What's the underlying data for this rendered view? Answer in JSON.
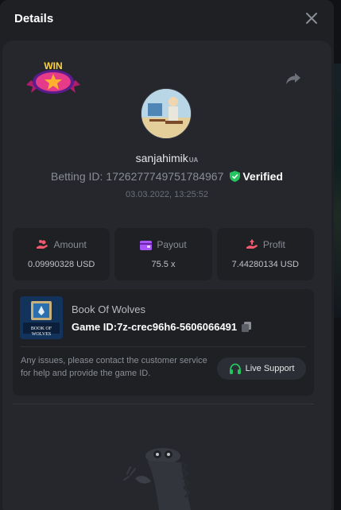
{
  "header": {
    "title": "Details"
  },
  "player": {
    "username": "sanjahimik",
    "country_code": "UA",
    "betting_id_label": "Betting ID:",
    "betting_id": "1726277749751784967",
    "verified_label": "Verified",
    "datetime": "03.03.2022, 13:25:52"
  },
  "badge": {
    "text": "WIN"
  },
  "stats": [
    {
      "label": "Amount",
      "value": "0.09990328 USD",
      "icon": "coins-hand-icon"
    },
    {
      "label": "Payout",
      "value": "75.5 x",
      "icon": "wallet-icon"
    },
    {
      "label": "Profit",
      "value": "7.44280134 USD",
      "icon": "profit-hand-icon"
    }
  ],
  "game": {
    "name": "Book Of Wolves",
    "id_label": "Game ID:",
    "id_value": "7z-crec96h6-5606066491",
    "thumb_caption": "BOOK OF WOLVES"
  },
  "support": {
    "message": "Any issues, please contact the customer service for help and provide the game ID.",
    "button_label": "Live Support"
  },
  "colors": {
    "modal_bg": "#1e2024",
    "panel_bg": "#25272c",
    "verified_green": "#22c55e",
    "amount_icon": "#ef5b6c",
    "payout_icon": "#a855f7",
    "profit_icon": "#ef5b6c"
  }
}
